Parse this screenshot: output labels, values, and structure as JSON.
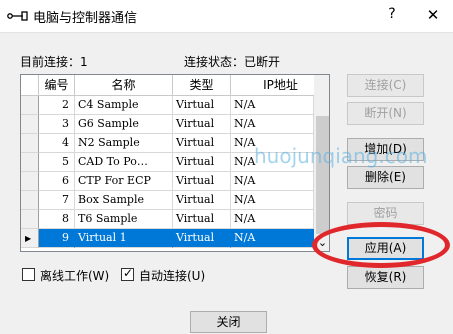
{
  "window": {
    "title": "电脑与控制器通信"
  },
  "status": {
    "current_connection": "目前连接：1",
    "connection_state": "连接状态：已断开"
  },
  "grid": {
    "columns": [
      "编号",
      "名称",
      "类型",
      "IP地址"
    ],
    "rows": [
      {
        "num": "2",
        "name": "C4 Sample",
        "type": "Virtual",
        "ip": "N/A"
      },
      {
        "num": "3",
        "name": "G6 Sample",
        "type": "Virtual",
        "ip": "N/A"
      },
      {
        "num": "4",
        "name": "N2 Sample",
        "type": "Virtual",
        "ip": "N/A"
      },
      {
        "num": "5",
        "name": "CAD To Po…",
        "type": "Virtual",
        "ip": "N/A"
      },
      {
        "num": "6",
        "name": "CTP For ECP",
        "type": "Virtual",
        "ip": "N/A"
      },
      {
        "num": "7",
        "name": "Box Sample",
        "type": "Virtual",
        "ip": "N/A"
      },
      {
        "num": "8",
        "name": "T6 Sample",
        "type": "Virtual",
        "ip": "N/A"
      },
      {
        "num": "9",
        "name": "Virtual 1",
        "type": "Virtual",
        "ip": "N/A"
      }
    ],
    "selected_index": 7
  },
  "buttons": {
    "connect": "连接(C)",
    "disconnect": "断开(N)",
    "add": "增加(D)",
    "delete": "删除(E)",
    "password": "密码",
    "apply": "应用(A)",
    "restore": "恢复(R)",
    "close": "关闭"
  },
  "checkboxes": {
    "offline": {
      "label": "离线工作(W)",
      "checked": false
    },
    "auto_connect": {
      "label": "自动连接(U)",
      "checked": true
    }
  },
  "watermark": "huojunqiang.com",
  "colors": {
    "selection": "#0078d7",
    "highlight_ring": "#e0282c"
  }
}
